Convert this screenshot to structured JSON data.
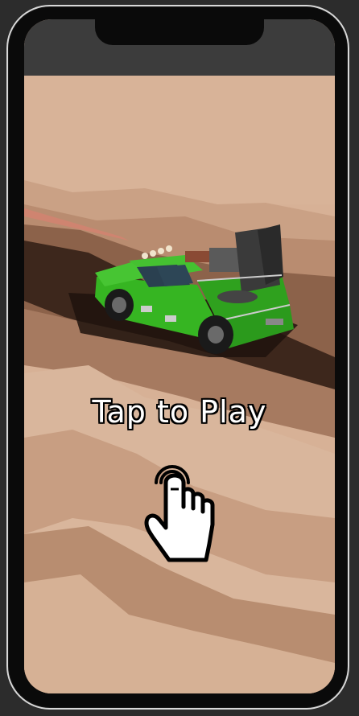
{
  "prompt": {
    "label": "Tap to Play"
  },
  "icons": {
    "hand": "tap-hand-icon",
    "car": "green-pickup-truck"
  },
  "colors": {
    "sky": "#3a3a3a",
    "sand_light": "#d9b59b",
    "sand_mid": "#c19478",
    "sand_dark": "#8a6046",
    "shadow": "#2b1c14",
    "truck_green": "#38b524",
    "text": "#ffffff",
    "outline": "#000000"
  }
}
